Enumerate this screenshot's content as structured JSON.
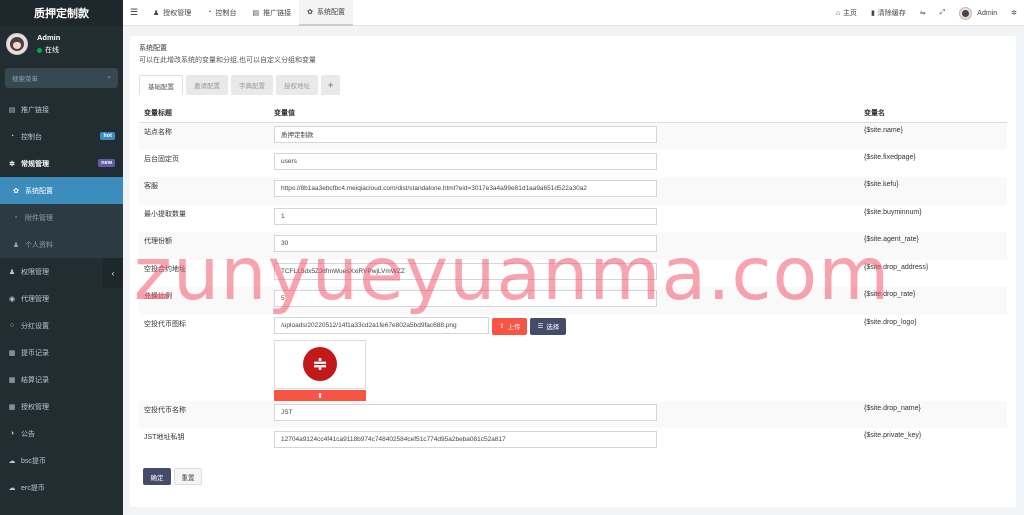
{
  "app": {
    "title": "质押定制款"
  },
  "user": {
    "name": "Admin",
    "status": "在线"
  },
  "search": {
    "placeholder": "搜索菜单"
  },
  "sidebar": {
    "items": [
      {
        "label": "推广链接",
        "icon": "file-icon"
      },
      {
        "label": "控制台",
        "icon": "dashboard-icon",
        "badge": "hot"
      },
      {
        "label": "常规管理",
        "icon": "cogs-icon",
        "badge": "new"
      },
      {
        "label": "系统配置",
        "icon": "gear-icon"
      },
      {
        "label": "附件管理",
        "icon": "file-image-icon"
      },
      {
        "label": "个人资料",
        "icon": "user-icon"
      },
      {
        "label": "权限管理",
        "icon": "group-icon"
      },
      {
        "label": "代理管理",
        "icon": "user-circle-icon"
      },
      {
        "label": "分红设置",
        "icon": "circle-icon"
      },
      {
        "label": "提币记录",
        "icon": "list-icon"
      },
      {
        "label": "结算记录",
        "icon": "list-icon"
      },
      {
        "label": "授权管理",
        "icon": "list-icon"
      },
      {
        "label": "公告",
        "icon": "adjust-icon"
      },
      {
        "label": "bsc提币",
        "icon": "cloud-icon"
      },
      {
        "label": "erc提币",
        "icon": "cloud-icon"
      }
    ]
  },
  "topnav": {
    "tabs": [
      {
        "label": "授权管理",
        "icon": "users-icon"
      },
      {
        "label": "控制台",
        "icon": "dashboard-icon"
      },
      {
        "label": "推广链接",
        "icon": "file-icon"
      },
      {
        "label": "系统配置",
        "icon": "gear-icon"
      }
    ],
    "right": {
      "home": "主页",
      "clear": "清除缓存",
      "user": "Admin"
    }
  },
  "panel": {
    "title": "系统配置",
    "description": "可以在此增改系统的变量和分组,也可以自定义分组和变量",
    "tabs": [
      "基础配置",
      "邀请配置",
      "字典配置",
      "授权地址",
      "+"
    ]
  },
  "table": {
    "headers": [
      "变量标题",
      "变量值",
      "变量名"
    ],
    "rows": [
      {
        "title": "站点名称",
        "value": "质押定制款",
        "name": "{$site.name}"
      },
      {
        "title": "后台固定页",
        "value": "users",
        "name": "{$site.fixedpage}"
      },
      {
        "title": "客服",
        "value": "https://8b1aa3ebcfbc4.meiqiacloud.com/dist/standalone.html?eid=3017e3a4a99e81d1aa9a651d522a30a2",
        "name": "{$site.kefu}"
      },
      {
        "title": "最小提取数量",
        "value": "1",
        "name": "{$site.buyminnum}"
      },
      {
        "title": "代理份额",
        "value": "30",
        "name": "{$site.agent_rate}"
      },
      {
        "title": "空投合约地址",
        "value": "TCFLL5dx5ZJdfmWuesXxiRVPwjLVmWZZ",
        "name": "{$site.drop_address}"
      },
      {
        "title": "兑换比例",
        "value": "5",
        "name": "{$site.drop_rate}"
      }
    ],
    "image_row": {
      "title": "空投代币图标",
      "value": "/uploads/20220512/14f1a33cd2a1fe67e802a5bd9fac688.png",
      "name": "{$site.drop_logo}",
      "upload": "上传",
      "choose": "选择",
      "logo_glyph": "≑"
    },
    "rows2": [
      {
        "title": "空投代币名称",
        "value": "JST",
        "name": "{$site.drop_name}"
      },
      {
        "title": "JST地址私钥",
        "value": "12704a9124cc4f41ca9118b974c748402584cef51c774d95a2beba081c52a817",
        "name": "{$site.private_key}"
      }
    ]
  },
  "actions": {
    "ok": "确定",
    "reset": "重置"
  },
  "watermark": "zunyueyuanma.com"
}
